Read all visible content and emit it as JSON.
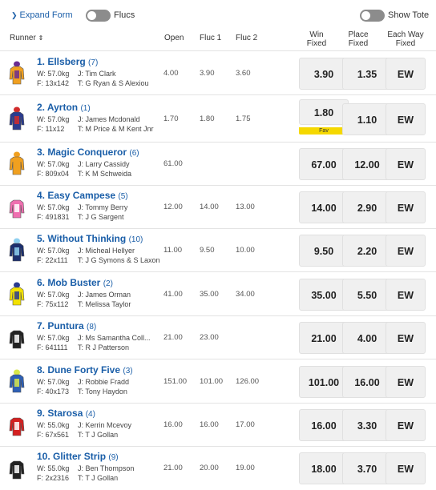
{
  "topbar": {
    "expand_label": "Expand Form",
    "flucs_label": "Flucs",
    "show_tote_label": "Show Tote"
  },
  "columns": {
    "runner": "Runner",
    "open": "Open",
    "fluc1": "Fluc 1",
    "fluc2": "Fluc 2",
    "win_fixed": [
      "Win",
      "Fixed"
    ],
    "place_fixed": [
      "Place",
      "Fixed"
    ],
    "each_way_fixed": [
      "Each Way",
      "Fixed"
    ]
  },
  "colors": {
    "link": "#1a5ea8",
    "fav_badge": "#f5d800",
    "button_bg": "#f0f0f0"
  },
  "runners": [
    {
      "name": "1. Ellsberg",
      "barrier": "(7)",
      "weight": "W: 57.0kg",
      "jockey": "J: Tim Clark",
      "form": "F: 13x142",
      "trainer": "T: G Ryan & S Alexiou",
      "open": "4.00",
      "fluc1": "3.90",
      "fluc2": "3.60",
      "win": "3.90",
      "place": "1.35",
      "ew": "EW",
      "silk": "orange-purple-silk-icon"
    },
    {
      "name": "2. Ayrton",
      "barrier": "(1)",
      "weight": "W: 57.0kg",
      "jockey": "J: James Mcdonald",
      "form": "F: 11x12",
      "trainer": "T: M Price & M Kent Jnr",
      "open": "1.70",
      "fluc1": "1.80",
      "fluc2": "1.75",
      "win": "1.80",
      "place": "1.10",
      "ew": "EW",
      "fav": "Fav",
      "silk": "blue-red-silk-icon"
    },
    {
      "name": "3. Magic Conqueror",
      "barrier": "(6)",
      "weight": "W: 57.0kg",
      "jockey": "J: Larry Cassidy",
      "form": "F: 809x04",
      "trainer": "T: K M Schweida",
      "open": "61.00",
      "fluc1": "",
      "fluc2": "",
      "win": "67.00",
      "place": "12.00",
      "ew": "EW",
      "silk": "orange-silk-icon"
    },
    {
      "name": "4. Easy Campese",
      "barrier": "(5)",
      "weight": "W: 57.0kg",
      "jockey": "J: Tommy Berry",
      "form": "F: 491831",
      "trainer": "T: J G Sargent",
      "open": "12.00",
      "fluc1": "14.00",
      "fluc2": "13.00",
      "win": "14.00",
      "place": "2.90",
      "ew": "EW",
      "silk": "pink-silk-icon"
    },
    {
      "name": "5. Without Thinking",
      "barrier": "(10)",
      "weight": "W: 57.0kg",
      "jockey": "J: Micheal Hellyer",
      "form": "F: 22x111",
      "trainer": "T: J G Symons & S Laxon",
      "open": "11.00",
      "fluc1": "9.50",
      "fluc2": "10.00",
      "win": "9.50",
      "place": "2.20",
      "ew": "EW",
      "silk": "navy-lightblue-silk-icon"
    },
    {
      "name": "6. Mob Buster",
      "barrier": "(2)",
      "weight": "W: 57.0kg",
      "jockey": "J: James Orman",
      "form": "F: 75x112",
      "trainer": "T: Melissa Taylor",
      "open": "41.00",
      "fluc1": "35.00",
      "fluc2": "34.00",
      "win": "35.00",
      "place": "5.50",
      "ew": "EW",
      "silk": "yellow-silk-icon"
    },
    {
      "name": "7. Puntura",
      "barrier": "(8)",
      "weight": "W: 57.0kg",
      "jockey": "J: Ms Samantha Coll...",
      "form": "F: 641111",
      "trainer": "T: R J Patterson",
      "open": "21.00",
      "fluc1": "23.00",
      "fluc2": "",
      "win": "21.00",
      "place": "4.00",
      "ew": "EW",
      "silk": "check-silk-icon"
    },
    {
      "name": "8. Dune Forty Five",
      "barrier": "(3)",
      "weight": "W: 57.0kg",
      "jockey": "J: Robbie Fradd",
      "form": "F: 40x173",
      "trainer": "T: Tony Haydon",
      "open": "151.00",
      "fluc1": "101.00",
      "fluc2": "126.00",
      "win": "101.00",
      "place": "16.00",
      "ew": "EW",
      "silk": "blue-yellow-check-silk-icon"
    },
    {
      "name": "9. Starosa",
      "barrier": "(4)",
      "weight": "W: 55.0kg",
      "jockey": "J: Kerrin Mcevoy",
      "form": "F: 67x561",
      "trainer": "T: T J Gollan",
      "open": "16.00",
      "fluc1": "16.00",
      "fluc2": "17.00",
      "win": "16.00",
      "place": "3.30",
      "ew": "EW",
      "silk": "red-star-silk-icon"
    },
    {
      "name": "10. Glitter Strip",
      "barrier": "(9)",
      "weight": "W: 55.0kg",
      "jockey": "J: Ben Thompson",
      "form": "F: 2x2316",
      "trainer": "T: T J Gollan",
      "open": "21.00",
      "fluc1": "20.00",
      "fluc2": "19.00",
      "win": "18.00",
      "place": "3.70",
      "ew": "EW",
      "silk": "black-white-silk-icon"
    }
  ]
}
